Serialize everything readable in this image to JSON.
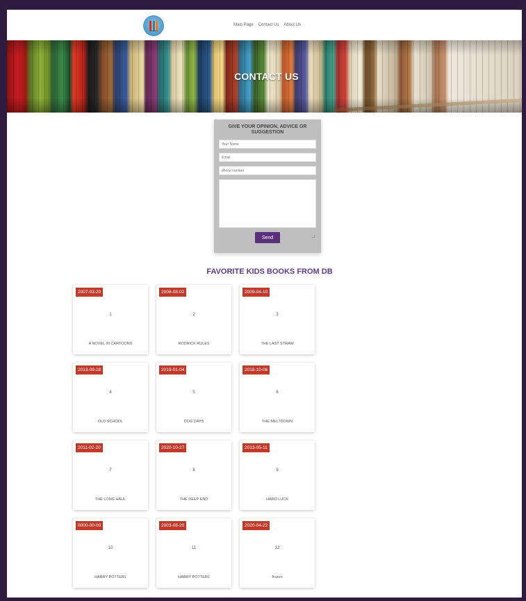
{
  "nav": {
    "items": [
      "Main Page",
      "Contact Us",
      "About Us"
    ]
  },
  "hero": {
    "title": "CONTACT US"
  },
  "form": {
    "heading": "GIVE YOUR OPINION, ADVICE OR SUGGESTION",
    "name_placeholder": "Your Name",
    "email_placeholder": "Email",
    "phone_placeholder": "phone number",
    "message_value": "",
    "send_label": "Send"
  },
  "books_section": {
    "title": "FAVORITE KIDS BOOKS FROM DB",
    "books": [
      {
        "date": "2007-03-20",
        "num": "1",
        "title": "A NOVEL IN CARTOONS"
      },
      {
        "date": "2008-08-02",
        "num": "2",
        "title": "RODRICK RULES"
      },
      {
        "date": "2009-04-10",
        "num": "3",
        "title": "THE LAST STRAW"
      },
      {
        "date": "2013-09-28",
        "num": "4",
        "title": "OLD SCHOOL"
      },
      {
        "date": "2019-01-04",
        "num": "5",
        "title": "DOG DAYS"
      },
      {
        "date": "2018-10-06",
        "num": "6",
        "title": "THE MELTDOWN"
      },
      {
        "date": "2011-02-20",
        "num": "7",
        "title": "THE LONG HAUL"
      },
      {
        "date": "2020-10-27",
        "num": "8",
        "title": "THE DEEP END"
      },
      {
        "date": "2013-05-11",
        "num": "9",
        "title": "HARD LUCK"
      },
      {
        "date": "0000-00-00",
        "num": "10",
        "title": "HARRY POTTER1"
      },
      {
        "date": "2003-08-20",
        "num": "11",
        "title": "HARRY POTTER1"
      },
      {
        "date": "2020-04-22",
        "num": "12",
        "title": "frozen"
      }
    ]
  },
  "colors": {
    "frame": "#2e1b3f",
    "accent_purple": "#5e3b86",
    "button_purple": "#5b2f7a",
    "badge_red": "#c0392b",
    "form_gray": "#bfbfbf"
  }
}
